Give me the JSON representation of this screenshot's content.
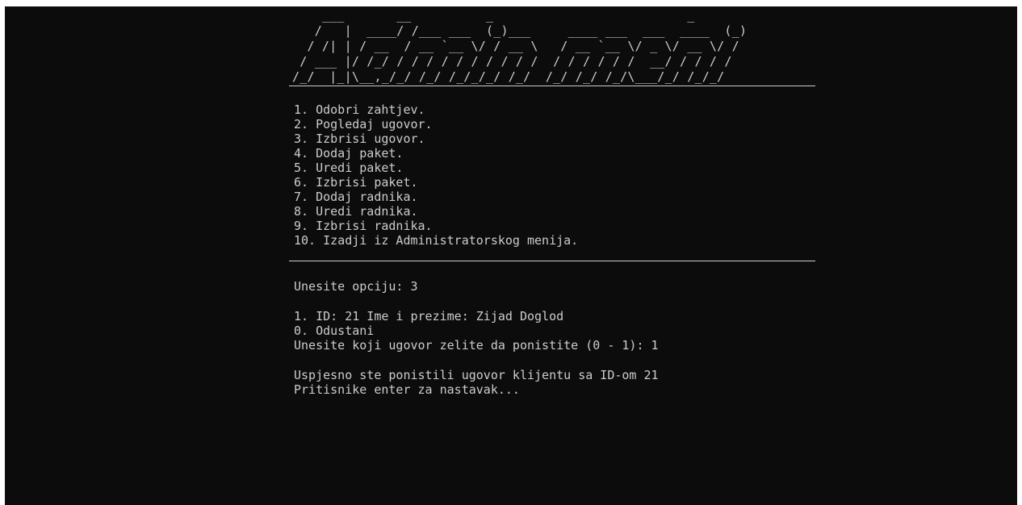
{
  "banner": {
    "art": "    ___       __          _                          _ \n   /   |  ____/ /___ ___  (_)___     ____ ___  ___  ____  (_)\n  / /| | / __  / __ `__ \\/ / __ \\   / __ `__ \\/ _ \\/ __ \\/ / \n / ___ |/ /_/ / / / / / / / / / /  / / / / / /  __/ / / / /  \n/_/  |_|\\__,_/_/ /_/ /_/_/_/ /_/  /_/ /_/ /_/\\___/_/ /_/_/   "
  },
  "menu": {
    "items": [
      "1. Odobri zahtjev.",
      "2. Pogledaj ugovor.",
      "3. Izbrisi ugovor.",
      "4. Dodaj paket.",
      "5. Uredi paket.",
      "6. Izbrisi paket.",
      "7. Dodaj radnika.",
      "8. Uredi radnika.",
      "9. Izbrisi radnika.",
      "10. Izadji iz Administratorskog menija."
    ]
  },
  "prompt": {
    "label": "Unesite opciju: ",
    "value": "3"
  },
  "contracts": {
    "options": [
      "1. ID: 21 Ime i prezime: Zijad Doglod",
      "0. Odustani"
    ],
    "question_label": "Unesite koji ugovor zelite da ponistite (0 - 1): ",
    "question_value": "1"
  },
  "result": {
    "message": "Uspjesno ste ponistili ugovor klijentu sa ID-om 21",
    "continue": "Pritisnike enter za nastavak..."
  },
  "colors": {
    "background": "#0c0c0c",
    "text": "#cccccc"
  }
}
